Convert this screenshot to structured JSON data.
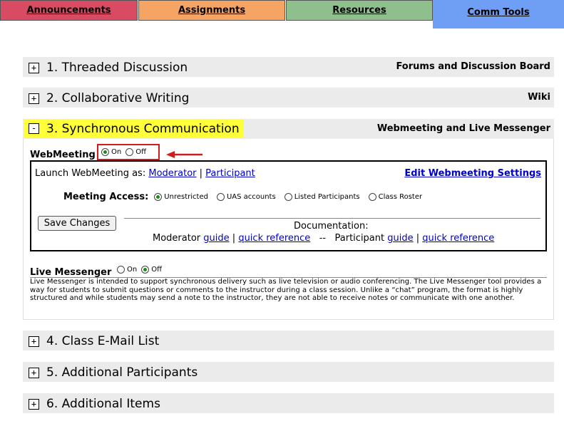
{
  "tabs": [
    {
      "label": "Announcements"
    },
    {
      "label": "Assignments"
    },
    {
      "label": "Resources"
    },
    {
      "label": "Comm Tools"
    }
  ],
  "sections": [
    {
      "toggle": "+",
      "title": "1. Threaded Discussion",
      "right": "Forums and Discussion Board"
    },
    {
      "toggle": "+",
      "title": "2. Collaborative Writing",
      "right": "Wiki"
    },
    {
      "toggle": "-",
      "title": "3. Synchronous Communication",
      "right": "Webmeeting and Live Messenger"
    },
    {
      "toggle": "+",
      "title": "4. Class E-Mail List"
    },
    {
      "toggle": "+",
      "title": "5. Additional Participants"
    },
    {
      "toggle": "+",
      "title": "6. Additional Items"
    }
  ],
  "webmeeting": {
    "label": "WebMeeting",
    "on_label": "On",
    "off_label": "Off",
    "selected": "On",
    "launch_text": "Launch WebMeeting as:",
    "moderator_link": "Moderator",
    "separator": "|",
    "participant_link": "Participant",
    "edit_settings_link": "Edit Webmeeting Settings",
    "access_label": "Meeting Access:",
    "access_options": [
      "Unrestricted",
      "UAS accounts",
      "Listed Participants",
      "Class Roster"
    ],
    "access_selected": "Unrestricted",
    "save_button": "Save Changes",
    "documentation_label": "Documentation:",
    "moderator_text": "Moderator",
    "guide_link": "guide",
    "quick_reference_link": "quick reference",
    "dashes": "--",
    "participant_text": "Participant"
  },
  "live_messenger": {
    "label": "Live Messenger",
    "on_label": "On",
    "off_label": "Off",
    "selected": "Off",
    "description": "Live Messenger is intended to support synchronous delivery such as live television or audio conferencing. The Live Messenger tool provides a way for students to submit questions or comments to the instructor during a class session. Unlike a “chat” program, the format is highly structured and while students may send a note to the instructor, they are not able to receive notes or communicate with one another."
  },
  "colors": {
    "tab_announcements": "#d84b63",
    "tab_assignments": "#f6a464",
    "tab_resources": "#8fbf8d",
    "tab_comm_tools": "#6f9ff4",
    "highlight": "#ffff3a",
    "annotation_red": "#d01c1c"
  }
}
